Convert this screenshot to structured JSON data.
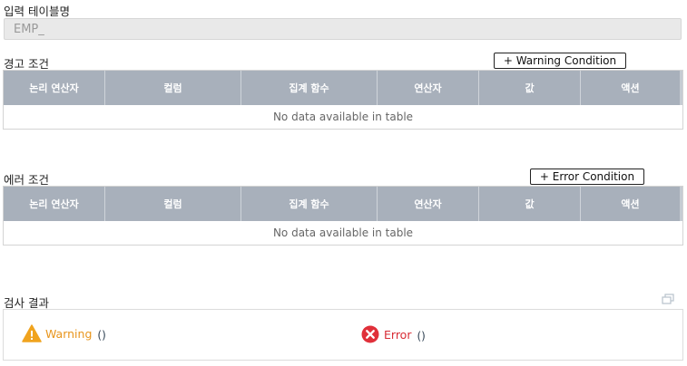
{
  "input_table": {
    "label": "입력 테이블명",
    "value": "EMP_"
  },
  "warning": {
    "label": "경고 조건",
    "button_label": "+ Warning Condition",
    "empty_text": "No data available in table"
  },
  "error": {
    "label": "에러 조건",
    "button_label": "+ Error Condition",
    "empty_text": "No data available in table"
  },
  "columns": [
    "논리 연산자",
    "컬럼",
    "집계 함수",
    "연산자",
    "값",
    "액션"
  ],
  "result": {
    "label": "검사 결과",
    "warning_label": "Warning",
    "warning_count": "()",
    "error_label": "Error",
    "error_count": "()",
    "warning_color": "#f0a31e",
    "error_color": "#e0303a"
  }
}
